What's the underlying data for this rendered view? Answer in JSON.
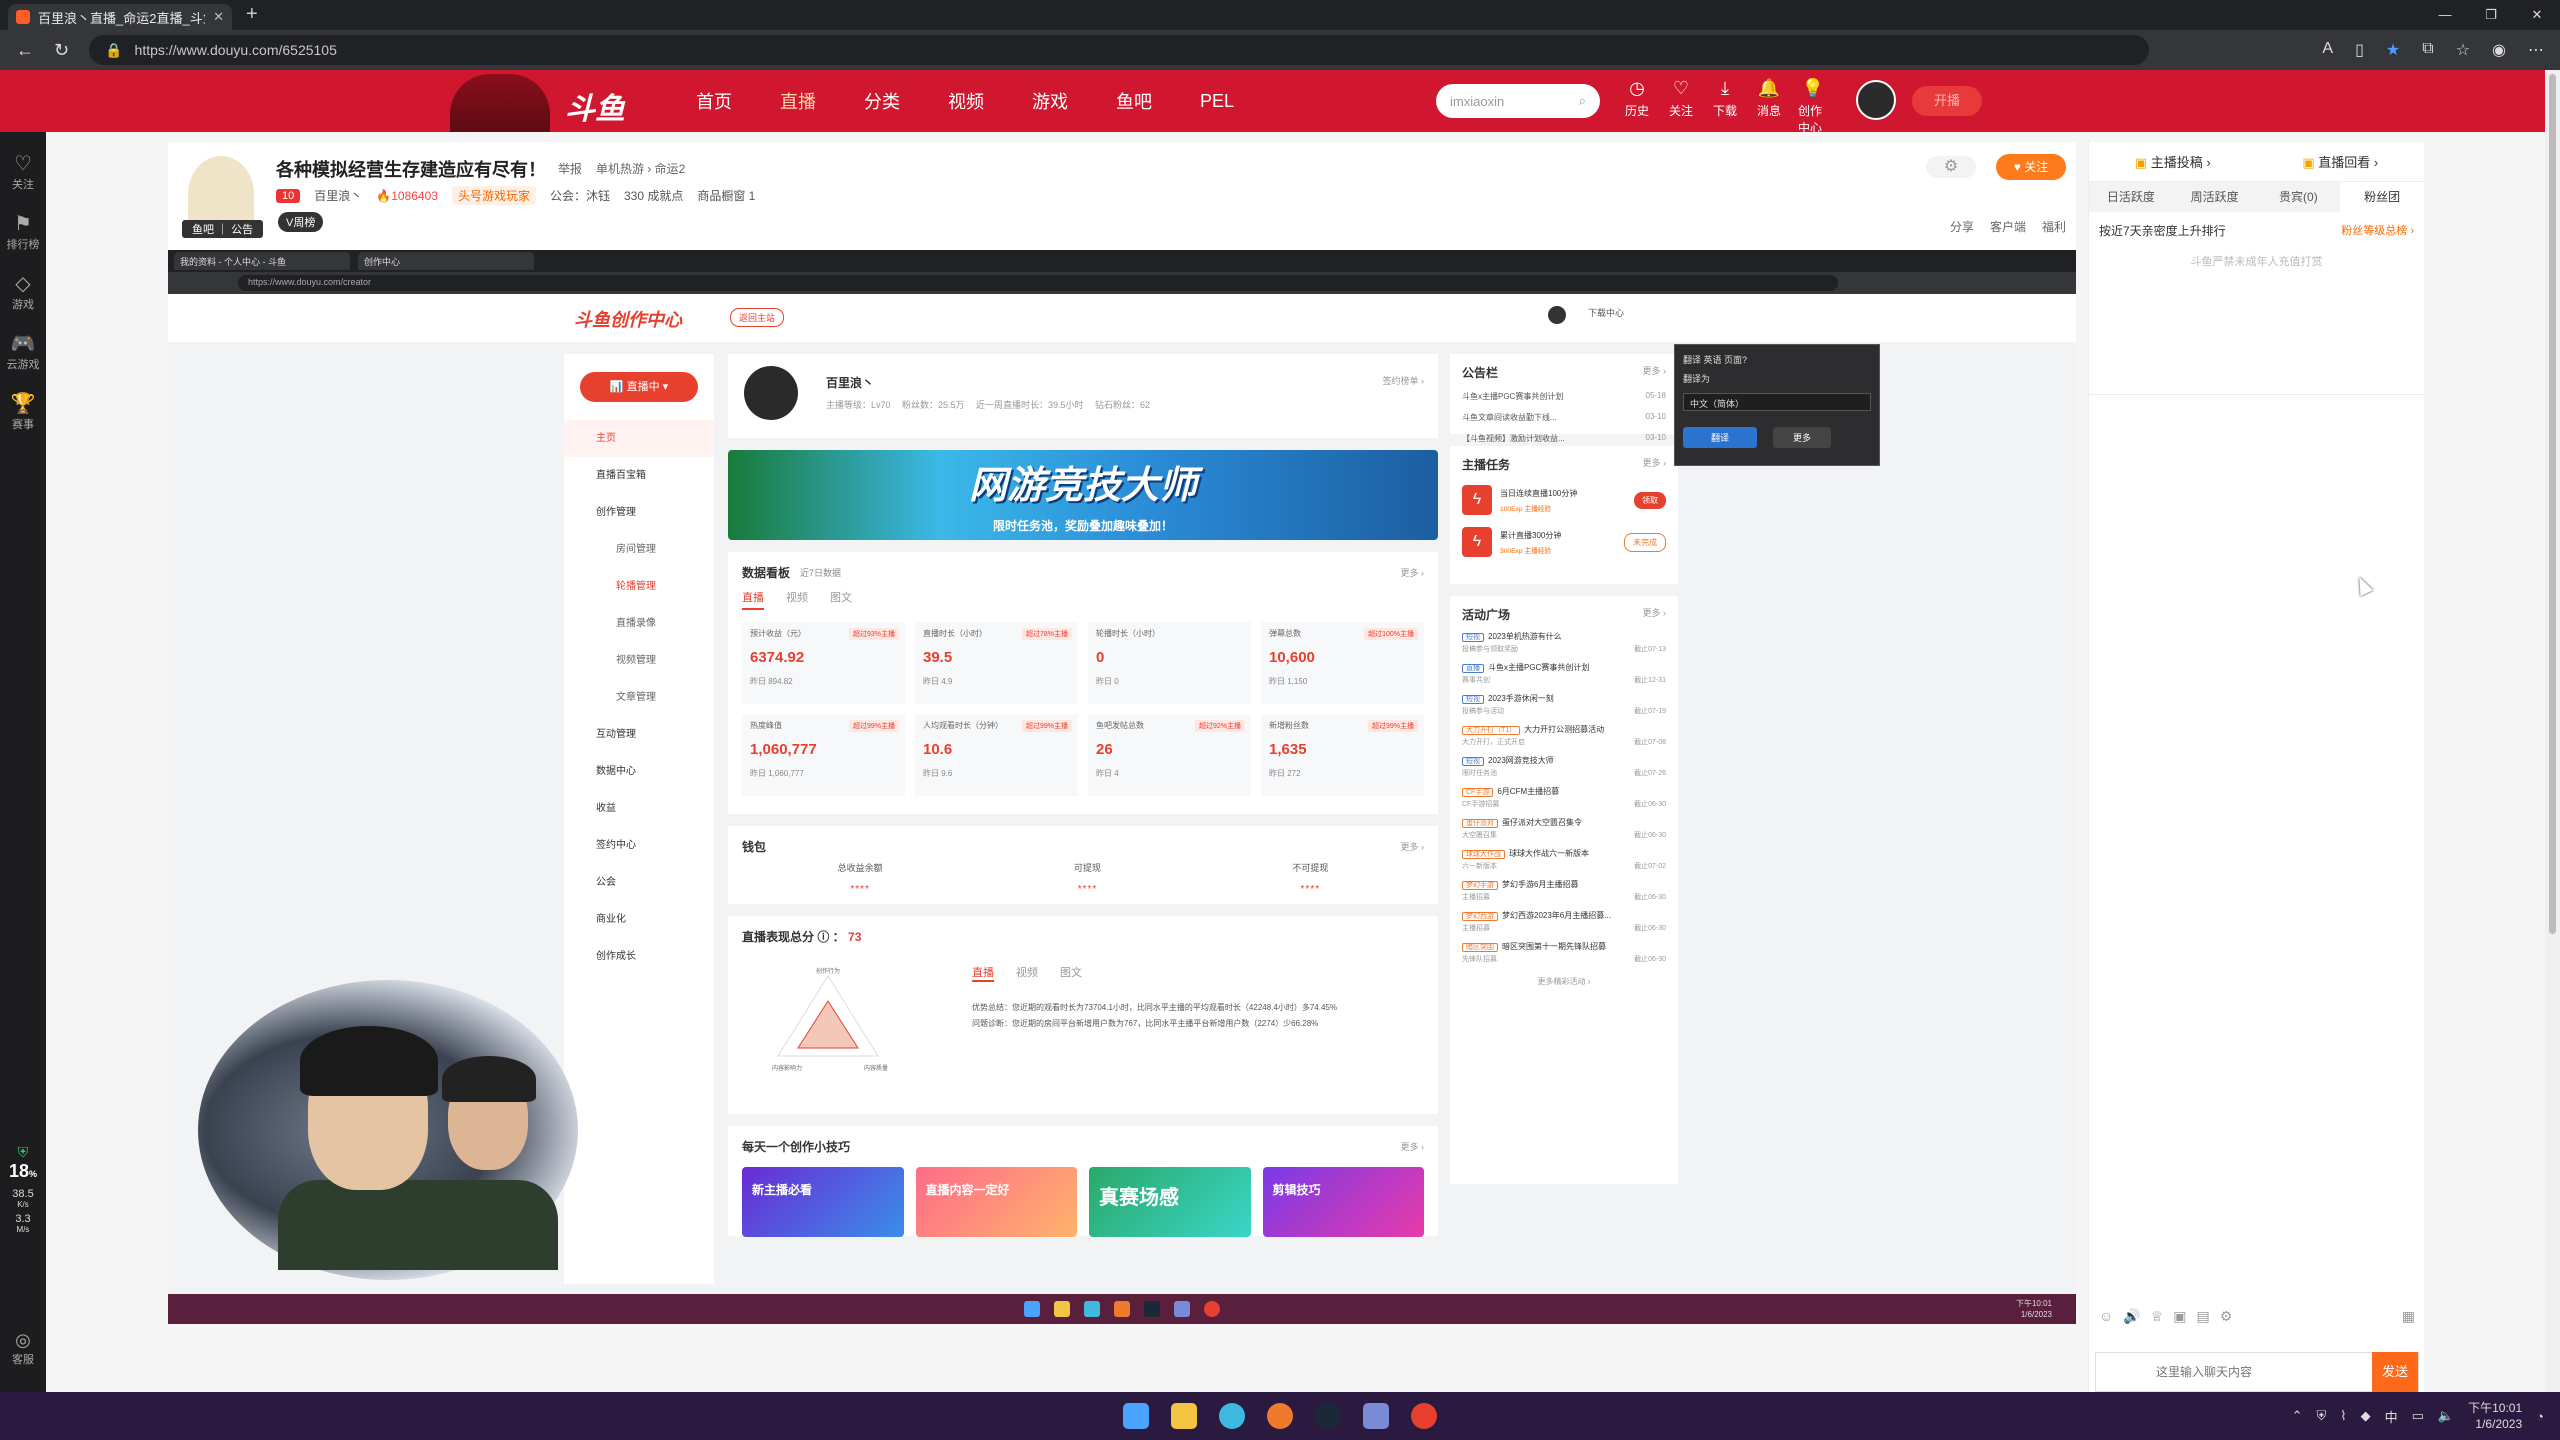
{
  "browser": {
    "tab_title": "百里浪丶直播_命运2直播_斗鱼直...",
    "url": "https://www.douyu.com/6525105"
  },
  "site_header": {
    "logo": "斗鱼",
    "nav": [
      "首页",
      "直播",
      "分类",
      "视频",
      "游戏",
      "鱼吧",
      "PEL"
    ],
    "active_nav": "直播",
    "search_placeholder": "imxiaoxin",
    "icons": [
      {
        "label": "历史",
        "icon": "history-icon"
      },
      {
        "label": "关注",
        "icon": "heart-icon"
      },
      {
        "label": "下载",
        "icon": "download-icon"
      },
      {
        "label": "消息",
        "icon": "bell-icon"
      },
      {
        "label": "创作中心",
        "icon": "bulb-icon"
      }
    ],
    "broadcast_label": "开播"
  },
  "left_sidebar": [
    {
      "label": "关注",
      "icon": "heart-icon"
    },
    {
      "label": "排行榜",
      "icon": "rank-icon"
    },
    {
      "label": "游戏",
      "icon": "game-icon"
    },
    {
      "label": "云游戏",
      "icon": "cloud-game-icon"
    },
    {
      "label": "赛事",
      "icon": "trophy-icon"
    }
  ],
  "left_stats": {
    "percent": "18",
    "percent_unit": "%",
    "up": "38.5",
    "up_unit": "K/s",
    "down": "3.3",
    "down_unit": "M/s",
    "service": "客服"
  },
  "room": {
    "title": "各种模拟经营生存建造应有尽有！",
    "report": "举报",
    "category": "单机热游 › 命运2",
    "level": "10",
    "streamer": "百里浪丶",
    "hotness": "1086403",
    "tag": "头号游戏玩家",
    "guild": "公会：沐钰",
    "achievements": "330 成就点",
    "product": "商品橱窗 1",
    "badge": "V周榜",
    "avatar_caption": "鱼吧 ｜ 公告",
    "follow": "关注",
    "actions": [
      "分享",
      "客户端",
      "福利"
    ]
  },
  "stream": {
    "inner_tabs": [
      "我的资料 - 个人中心 - 斗鱼",
      "创作中心"
    ],
    "inner_url": "https://www.douyu.com/creator",
    "creator_logo": "斗鱼创作中心",
    "back_label": "返回主站",
    "download_center": "下载中心",
    "live_btn": "直播中",
    "menu": [
      {
        "label": "主页",
        "type": "act"
      },
      {
        "label": "直播百宝箱",
        "type": ""
      },
      {
        "label": "创作管理",
        "type": ""
      },
      {
        "label": "房间管理",
        "type": "sub"
      },
      {
        "label": "轮播管理",
        "type": "subact"
      },
      {
        "label": "直播录像",
        "type": "sub"
      },
      {
        "label": "视频管理",
        "type": "sub"
      },
      {
        "label": "文章管理",
        "type": "sub"
      },
      {
        "label": "互动管理",
        "type": ""
      },
      {
        "label": "数据中心",
        "type": ""
      },
      {
        "label": "收益",
        "type": ""
      },
      {
        "label": "签约中心",
        "type": ""
      },
      {
        "label": "公会",
        "type": ""
      },
      {
        "label": "商业化",
        "type": ""
      },
      {
        "label": "创作成长",
        "type": ""
      }
    ],
    "profile": {
      "name": "百里浪丶",
      "meta": "主播等级：Lv70　 粉丝数：25.5万　 近一周直播时长：39.5小时　 钻石粉丝：62",
      "right": "签约榜单 ›"
    },
    "banner": {
      "title": "网游竞技大师",
      "subtitle": "限时任务池，奖励叠加趣味叠加！"
    },
    "dashboard": {
      "title": "数据看板",
      "range": "近7日数据",
      "more": "更多 ›",
      "tabs": [
        "直播",
        "视频",
        "图文"
      ],
      "metrics": [
        {
          "label": "预计收益（元）",
          "badge": "超过93%主播",
          "value": "6374.92",
          "yesterday": "昨日 894.82"
        },
        {
          "label": "直播时长（小时）",
          "badge": "超过78%主播",
          "value": "39.5",
          "yesterday": "昨日 4.9"
        },
        {
          "label": "轮播时长（小时）",
          "badge": "",
          "value": "0",
          "yesterday": "昨日 0"
        },
        {
          "label": "弹幕总数",
          "badge": "超过100%主播",
          "value": "10,600",
          "yesterday": "昨日 1,150"
        },
        {
          "label": "热度峰值",
          "badge": "超过99%主播",
          "value": "1,060,777",
          "yesterday": "昨日 1,060,777"
        },
        {
          "label": "人均观看时长（分钟）",
          "badge": "超过99%主播",
          "value": "10.6",
          "yesterday": "昨日 9.6"
        },
        {
          "label": "鱼吧发帖总数",
          "badge": "超过92%主播",
          "value": "26",
          "yesterday": "昨日 4"
        },
        {
          "label": "新增粉丝数",
          "badge": "超过99%主播",
          "value": "1,635",
          "yesterday": "昨日 272"
        }
      ]
    },
    "wallet": {
      "title": "钱包",
      "more": "更多 ›",
      "items": [
        "总收益余额",
        "可提现",
        "不可提现"
      ],
      "masked": "****"
    },
    "performance": {
      "title": "直播表现总分",
      "score": "73",
      "tabs": [
        "直播",
        "视频",
        "图文"
      ],
      "radar_labels": [
        "创作行为",
        "内容影响力",
        "内容质量"
      ],
      "lines": [
        "优势总结：您近期的观看时长为73704.1小时，比同水平主播的平均观看时长（42248.4小时）多74.45%",
        "问题诊断：您近期的房间平台新增用户数为767，比同水平主播平台新增用户数（2274）少66.28%"
      ]
    },
    "tips": {
      "title": "每天一个创作小技巧",
      "more": "更多 ›",
      "cards": [
        "新主播必看",
        "直播内容一定好",
        "真赛场感",
        "剪辑技巧"
      ]
    },
    "notice": {
      "title": "公告栏",
      "more": "更多 ›",
      "items": [
        {
          "text": "斗鱼x主播PGC赛事共创计划",
          "date": "05-18"
        },
        {
          "text": "斗鱼文章间读收益勤下线...",
          "date": "03-10"
        },
        {
          "text": "【斗鱼视频】激励计划收益...",
          "date": "03-10"
        }
      ]
    },
    "tasks": {
      "title": "主播任务",
      "more": "更多 ›",
      "items": [
        {
          "text": "当日连续直播100分钟",
          "reward": "100Exp 主播经验",
          "btn": "领取"
        },
        {
          "text": "累计直播300分钟",
          "reward": "300Exp 主播经验",
          "btn": "未完成"
        }
      ]
    },
    "activities": {
      "title": "活动广场",
      "more": "更多 ›",
      "footer": "更多精彩活动 ›",
      "items": [
        {
          "tag": "短视",
          "text": "2023单机热游有什么",
          "sub": "投稿参与领取奖励",
          "date": "截止07-13"
        },
        {
          "tag": "直播",
          "text": "斗鱼x主播PGC赛事共创计划",
          "sub": "赛事共创",
          "date": "截止12-31"
        },
        {
          "tag": "短视",
          "text": "2023手游休闲一刻",
          "sub": "投稿参与活动",
          "date": "截止07-19"
        },
        {
          "tag": "大力开打（T1）",
          "text": "大力开打公测招募活动",
          "sub": "大力开打，正式开启",
          "date": "截止07-08"
        },
        {
          "tag": "短视",
          "text": "2023网游竞技大师",
          "sub": "限时任务池",
          "date": "截止07-26"
        },
        {
          "tag": "CF手游",
          "text": "6月CFM主播招募",
          "sub": "CF手游招募",
          "date": "截止06-30"
        },
        {
          "tag": "蛋仔派对",
          "text": "蛋仔派对大空匮召集令",
          "sub": "大空匮召集",
          "date": "截止06-30"
        },
        {
          "tag": "球球大作战",
          "text": "球球大作战六一新版本",
          "sub": "六一新版本",
          "date": "截止07-02"
        },
        {
          "tag": "梦幻手游",
          "text": "梦幻手游6月主播招募",
          "sub": "主播招募",
          "date": "截止06-30"
        },
        {
          "tag": "梦幻西游",
          "text": "梦幻西游2023年6月主播招募...",
          "sub": "主播招募",
          "date": "截止06-30"
        },
        {
          "tag": "暗区突围",
          "text": "暗区突围第十一期先锋队招募",
          "sub": "先锋队招募",
          "date": "截止06-30"
        }
      ]
    },
    "translate_popup": {
      "title": "翻译 英语 页面?",
      "to": "翻译为",
      "lang": "中文（简体）",
      "translate": "翻译",
      "more": "更多"
    },
    "inner_clock": {
      "time": "下午10:01",
      "date": "1/6/2023"
    }
  },
  "right_panel": {
    "top": [
      "主播投稿 ›",
      "直播回看 ›"
    ],
    "tabs": [
      "日活跃度",
      "周活跃度",
      "贵宾(0)",
      "粉丝团"
    ],
    "rank_left": "按近7天亲密度上升排行",
    "rank_right": "粉丝等级总榜 ›",
    "note": "斗鱼严禁未成年人充值打赏",
    "chat_placeholder": "这里输入聊天内容",
    "send": "发送"
  },
  "taskbar": {
    "time": "下午10:01",
    "date": "1/6/2023",
    "ime": "中"
  },
  "colors": {
    "brand": "#d0172f",
    "accent": "#e8402f",
    "orange": "#ff7a1a"
  }
}
